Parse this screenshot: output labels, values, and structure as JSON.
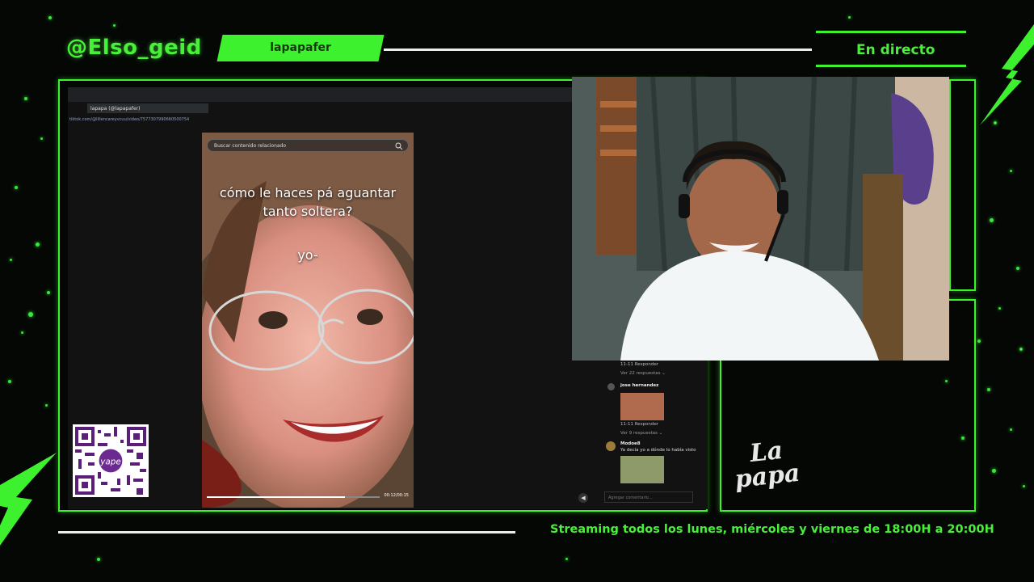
{
  "overlay": {
    "handle": "@Elso_geid",
    "username": "lapapafer",
    "live_label": "En directo",
    "schedule": "Streaming todos los lunes, miércoles y viernes de 18:00H a 20:00H",
    "logo_line1": "La",
    "logo_line2": "papa",
    "qr_label": "yape"
  },
  "browser": {
    "tab_title": "lapapa (@lapapafer)",
    "url": "tiktok.com/@lillencareyvcuu/video/7577307990660500754",
    "search_placeholder": "Buscar contenido relacionado"
  },
  "video": {
    "caption_line1": "cómo le haces pá aguantar",
    "caption_line2": "tanto soltera?",
    "caption_line3": "yo-",
    "time": "00:12/00:15",
    "progress": 0.8
  },
  "comments": {
    "reply_meta_1": "11-11     Responder",
    "replies_1": "Ver 22 respuestas ⌄",
    "author_2": "jose hernandez",
    "reply_meta_2": "11-11     Responder",
    "replies_2": "Ver 9 respuestas ⌄",
    "author_3": "Modoe8",
    "text_3": "Ya decía yo a dónde lo había visto",
    "add_comment": "Agregar comentario..."
  },
  "colors": {
    "accent": "#3ef12e",
    "background": "#050705"
  }
}
